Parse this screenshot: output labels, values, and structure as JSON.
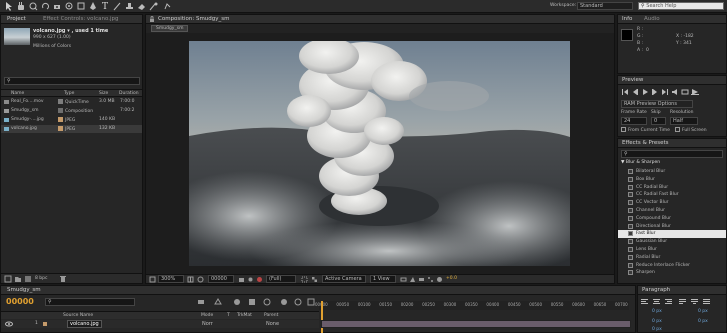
{
  "app": {
    "workspace_label": "Workspace:",
    "workspace_value": "Standard",
    "search_placeholder": "Search Help"
  },
  "project": {
    "tab": "Project",
    "effect_controls_tab": "Effect Controls: volcano.jpg",
    "file_name": "volcano.jpg ▾ , used 1 time",
    "dimensions": "990 x 627 (1.00)",
    "colors": "Millions of Colors",
    "columns": [
      "Name",
      "Type",
      "Size",
      "Duration"
    ],
    "items": [
      {
        "name": "Real_Fo....mov",
        "type": "QuickTime",
        "size": "3.0 MB",
        "duration": "7:00:0",
        "color": "#7d7d7d"
      },
      {
        "name": "Smudgy_sm",
        "type": "Composition",
        "size": "",
        "duration": "7:00:2",
        "color": "#6e6e6e"
      },
      {
        "name": "Smudgy-....jpg",
        "type": "JPEG",
        "size": "140 KB",
        "duration": "",
        "color": "#c59b6b"
      },
      {
        "name": "volcano.jpg",
        "type": "JPEG",
        "size": "132 KB",
        "duration": "",
        "color": "#c59b6b"
      }
    ],
    "bpc": "8 bpc"
  },
  "composition": {
    "tab": "Composition: Smudgy_sm",
    "subtab": "Smudgy_sm",
    "zoom": "300%",
    "timecode": "00000",
    "resolution": "(Full)",
    "camera": "Active Camera",
    "views": "1 View",
    "exposure": "+0.0"
  },
  "info": {
    "tab": "Info",
    "audio_tab": "Audio",
    "labels": [
      "R :",
      "G :",
      "B :",
      "A :"
    ],
    "a_value": "0",
    "x": "X : -182",
    "y": "Y : 341"
  },
  "preview": {
    "tab": "Preview",
    "ram_preview": "RAM Preview Options",
    "frame_rate_label": "Frame Rate",
    "skip_label": "Skip",
    "resolution_label": "Resolution",
    "frame_rate": "24",
    "skip": "0",
    "resolution": "Half",
    "from_current": "From Current Time",
    "full_screen": "Full Screen"
  },
  "effects": {
    "tab": "Effects & Presets",
    "category": "Blur & Sharpen",
    "items": [
      "Bilateral Blur",
      "Box Blur",
      "CC Radial Blur",
      "CC Radial Fast Blur",
      "CC Vector Blur",
      "Channel Blur",
      "Compound Blur",
      "Directional Blur",
      "Fast Blur",
      "Gaussian Blur",
      "Lens Blur",
      "Radial Blur",
      "Reduce Interlace Flicker",
      "Sharpen"
    ],
    "selected_index": 8
  },
  "timeline": {
    "tab": "Smudgy_sm",
    "timecode": "00000",
    "col_source": "Source Name",
    "col_mode": "Mode",
    "col_t": "T",
    "col_trkmat": "TrkMat",
    "col_parent": "Parent",
    "layer_index": "1",
    "layer_name": "volcano.jpg",
    "layer_mode": "Norr",
    "layer_parent": "None",
    "ruler": [
      "00000",
      "00050",
      "00100",
      "00150",
      "00200",
      "00250",
      "00300",
      "00350",
      "00400",
      "00450",
      "00500",
      "00550",
      "00600",
      "00650",
      "00700"
    ],
    "paragraph_tab": "Paragraph",
    "para_px": [
      "0 px",
      "0 px",
      "0 px",
      "0 px",
      "0 px"
    ]
  }
}
